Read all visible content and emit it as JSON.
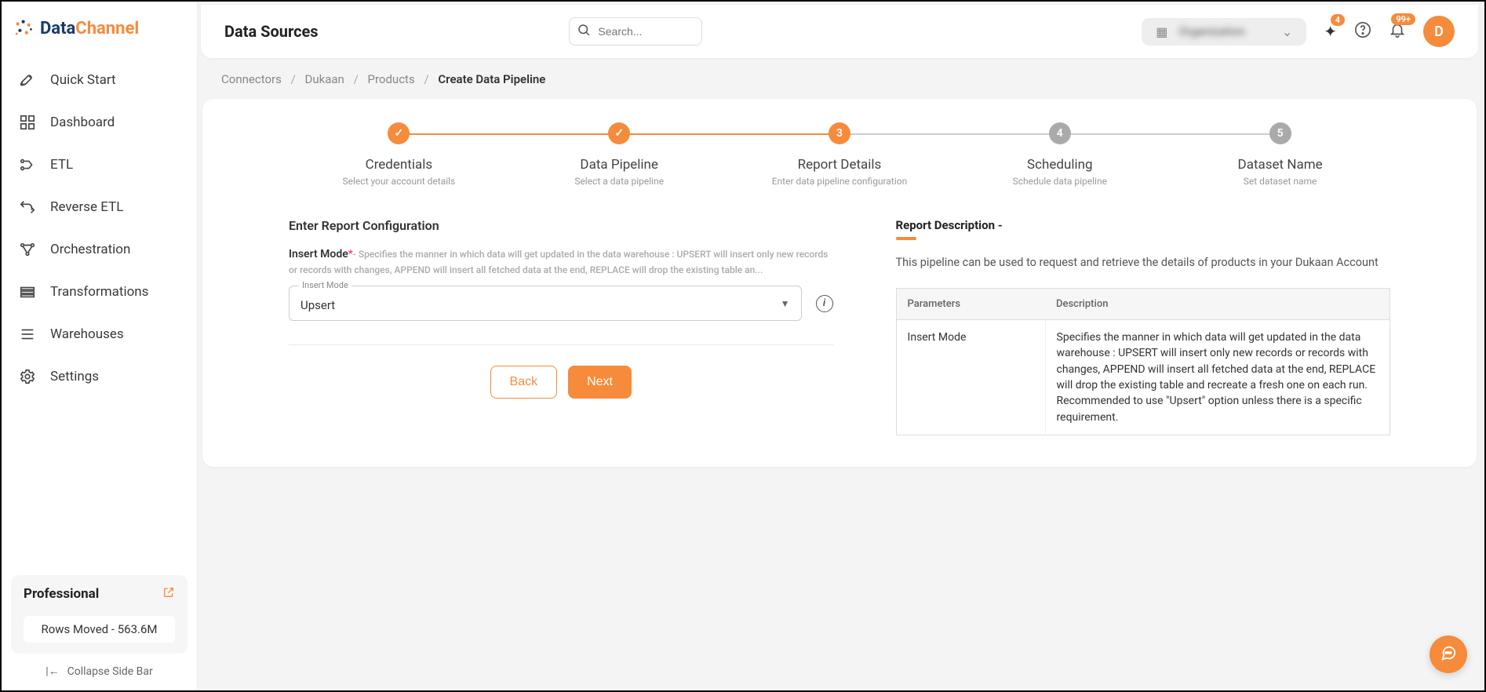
{
  "brand": {
    "name_part1": "Data",
    "name_part2": "Channel"
  },
  "sidebar": {
    "items": [
      {
        "label": "Quick Start"
      },
      {
        "label": "Dashboard"
      },
      {
        "label": "ETL"
      },
      {
        "label": "Reverse ETL"
      },
      {
        "label": "Orchestration"
      },
      {
        "label": "Transformations"
      },
      {
        "label": "Warehouses"
      },
      {
        "label": "Settings"
      }
    ],
    "plan": {
      "name": "Professional",
      "rows": "Rows Moved - 563.6M"
    },
    "collapse_label": "Collapse Side Bar"
  },
  "header": {
    "page_title": "Data Sources",
    "search_placeholder": "Search...",
    "org_name": "Organization",
    "sparkle_badge": "4",
    "bell_badge": "99+",
    "avatar_initial": "D"
  },
  "breadcrumbs": {
    "items": [
      "Connectors",
      "Dukaan",
      "Products",
      "Create Data Pipeline"
    ]
  },
  "stepper": [
    {
      "title": "Credentials",
      "sub": "Select your account details",
      "state": "done",
      "mark": "✓"
    },
    {
      "title": "Data Pipeline",
      "sub": "Select a data pipeline",
      "state": "done",
      "mark": "✓"
    },
    {
      "title": "Report Details",
      "sub": "Enter data pipeline configuration",
      "state": "active",
      "mark": "3"
    },
    {
      "title": "Scheduling",
      "sub": "Schedule data pipeline",
      "state": "pending",
      "mark": "4"
    },
    {
      "title": "Dataset Name",
      "sub": "Set dataset name",
      "state": "pending",
      "mark": "5"
    }
  ],
  "form": {
    "section_title": "Enter Report Configuration",
    "field": {
      "name": "Insert Mode",
      "required_mark": "*",
      "desc_prefix": "- ",
      "desc": "Specifies the manner in which data will get updated in the data warehouse : UPSERT will insert only new records or records with changes, APPEND will insert all fetched data at the end, REPLACE will drop the existing table an",
      "desc_ellipsis": "...",
      "float_label": "Insert Mode",
      "value": "Upsert"
    },
    "back_label": "Back",
    "next_label": "Next"
  },
  "description": {
    "heading": "Report Description -",
    "text": "This pipeline can be used to request and retrieve the details of products in your Dukaan Account",
    "table": {
      "col1": "Parameters",
      "col2": "Description",
      "rows": [
        {
          "param": "Insert Mode",
          "desc": "Specifies the manner in which data will get updated in the data warehouse : UPSERT will insert only new records or records with changes, APPEND will insert all fetched data at the end, REPLACE will drop the existing table and recreate a fresh one on each run. Recommended to use \"Upsert\" option unless there is a specific requirement."
        }
      ]
    }
  }
}
